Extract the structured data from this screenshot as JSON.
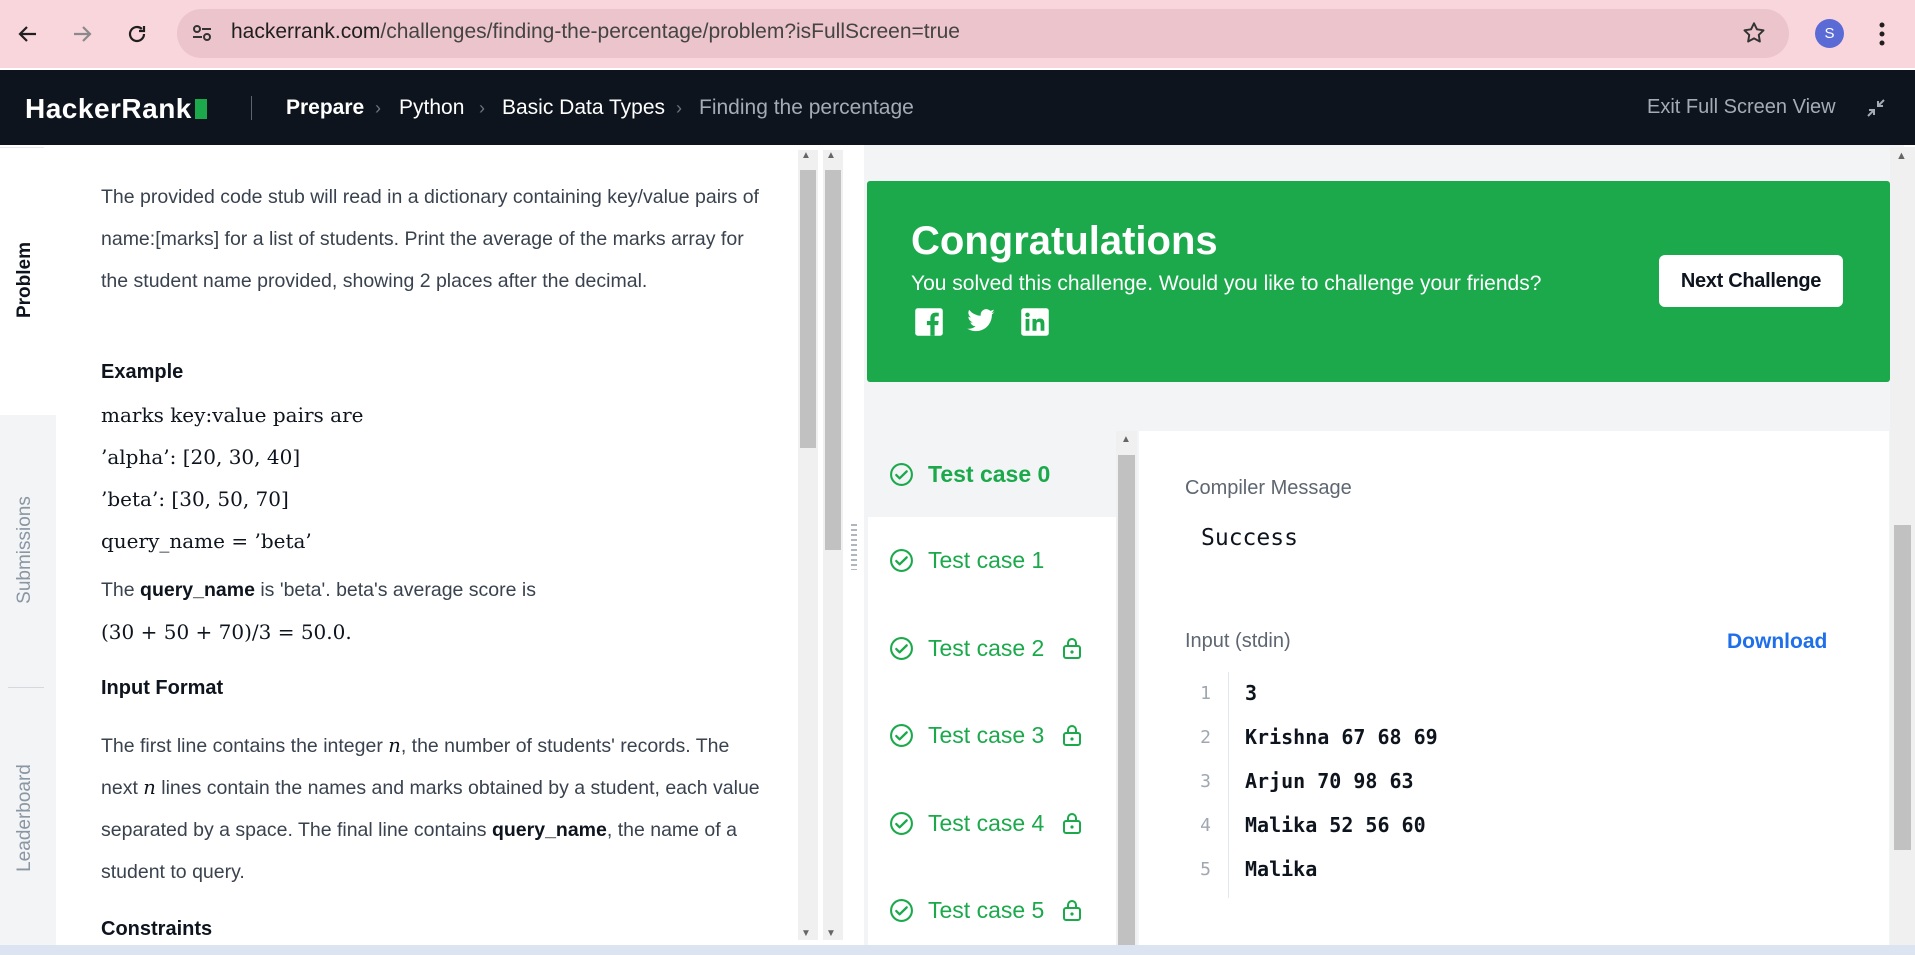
{
  "browser": {
    "url_host": "hackerrank.com",
    "url_path": "/challenges/finding-the-percentage/problem?isFullScreen=true",
    "avatar_letter": "S"
  },
  "header": {
    "logo": "HackerRank",
    "breadcrumbs": [
      "Prepare",
      "Python",
      "Basic Data Types",
      "Finding the percentage"
    ],
    "exit_fullscreen": "Exit Full Screen View"
  },
  "side_tabs": [
    "Problem",
    "Submissions",
    "Leaderboard"
  ],
  "problem": {
    "intro": "The provided code stub will read in a dictionary containing key/value pairs of name:[marks] for a list of students. Print the average of the marks array for the student name provided, showing 2 places after the decimal.",
    "example_heading": "Example",
    "example_lines": [
      "marks key:value pairs are",
      "’alpha’: [20, 30, 40]",
      "’beta’: [30, 50, 70]",
      "query_name = ’beta’"
    ],
    "explain_pre": "The ",
    "explain_bold": "query_name",
    "explain_post": " is 'beta'. beta's average score is",
    "explain_formula": "(30 + 50 + 70)/3 = 50.0.",
    "input_heading": "Input Format",
    "input_p1": "The first line contains the integer ",
    "input_n": "n",
    "input_p2": ", the number of students' records. The next ",
    "input_p3": " lines contain the names and marks obtained by a student, each value separated by a space. The final line contains ",
    "input_bold": "query_name",
    "input_p4": ", the name of a student to query.",
    "constraints_heading": "Constraints"
  },
  "congrats": {
    "title": "Congratulations",
    "subtitle": "You solved this challenge. Would you like to challenge your friends?",
    "next_button": "Next Challenge",
    "social": [
      "facebook-icon",
      "twitter-icon",
      "linkedin-icon"
    ],
    "color": "#1ba94c"
  },
  "test_cases": [
    {
      "label": "Test case 0",
      "locked": false,
      "selected": true
    },
    {
      "label": "Test case 1",
      "locked": false,
      "selected": false
    },
    {
      "label": "Test case 2",
      "locked": true,
      "selected": false
    },
    {
      "label": "Test case 3",
      "locked": true,
      "selected": false
    },
    {
      "label": "Test case 4",
      "locked": true,
      "selected": false
    },
    {
      "label": "Test case 5",
      "locked": true,
      "selected": false
    }
  ],
  "result": {
    "compiler_label": "Compiler Message",
    "compiler_value": "Success",
    "input_label": "Input (stdin)",
    "download": "Download",
    "input_lines": [
      {
        "n": "1",
        "text": "3"
      },
      {
        "n": "2",
        "text": "Krishna 67 68 69"
      },
      {
        "n": "3",
        "text": "Arjun 70 98 63"
      },
      {
        "n": "4",
        "text": "Malika 52 56 60"
      },
      {
        "n": "5",
        "text": "Malika"
      }
    ]
  }
}
